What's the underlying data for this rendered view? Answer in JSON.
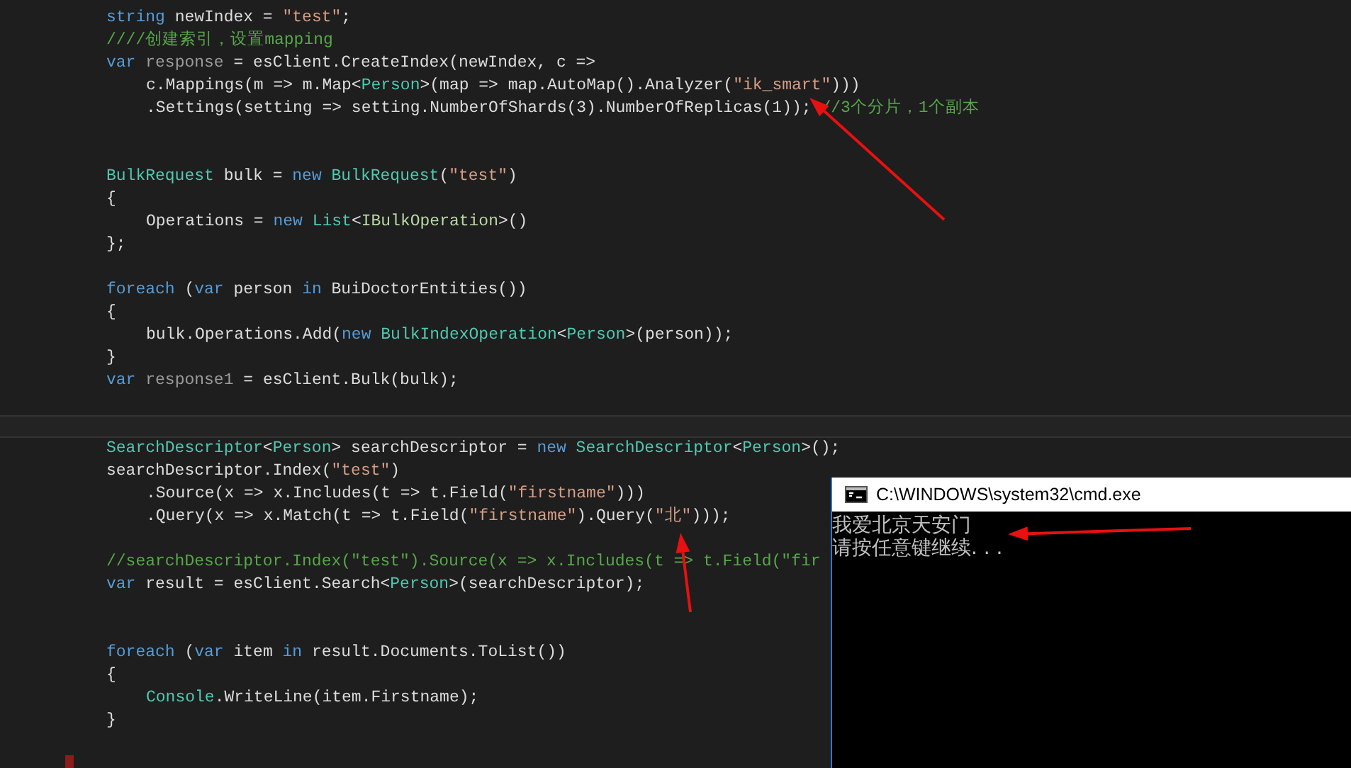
{
  "editor": {
    "lines": [
      {
        "kind": "code",
        "tokens": [
          {
            "kind": "keyword",
            "s": "string"
          },
          {
            "kind": "plain",
            "s": " newIndex = "
          },
          {
            "kind": "string",
            "s": "\"test\""
          },
          {
            "kind": "plain",
            "s": ";"
          }
        ]
      },
      {
        "kind": "code",
        "tokens": [
          {
            "kind": "comment",
            "s": "////创建索引，设置mapping"
          }
        ]
      },
      {
        "kind": "code",
        "tokens": [
          {
            "kind": "keyword",
            "s": "var"
          },
          {
            "kind": "unused",
            "s": " response"
          },
          {
            "kind": "plain",
            "s": " = esClient.CreateIndex(newIndex, c =>"
          }
        ]
      },
      {
        "kind": "indented",
        "tokens": [
          {
            "kind": "plain",
            "s": "c.Mappings(m => m.Map<"
          },
          {
            "kind": "type",
            "s": "Person"
          },
          {
            "kind": "plain",
            "s": ">(map => map.AutoMap().Analyzer("
          },
          {
            "kind": "string",
            "s": "\"ik_smart\""
          },
          {
            "kind": "plain",
            "s": ")))"
          }
        ]
      },
      {
        "kind": "indented",
        "tokens": [
          {
            "kind": "plain",
            "s": ".Settings(setting => setting.NumberOfShards(3).NumberOfReplicas(1)); "
          },
          {
            "kind": "comment",
            "s": "//3个分片，1个副本"
          }
        ]
      },
      {
        "kind": "blank"
      },
      {
        "kind": "blank"
      },
      {
        "kind": "code",
        "tokens": [
          {
            "kind": "type",
            "s": "BulkRequest"
          },
          {
            "kind": "plain",
            "s": " bulk = "
          },
          {
            "kind": "keyword",
            "s": "new"
          },
          {
            "kind": "type",
            "s": " BulkRequest"
          },
          {
            "kind": "plain",
            "s": "("
          },
          {
            "kind": "string",
            "s": "\"test\""
          },
          {
            "kind": "plain",
            "s": ")"
          }
        ]
      },
      {
        "kind": "code",
        "tokens": [
          {
            "kind": "plain",
            "s": "{"
          }
        ]
      },
      {
        "kind": "indented",
        "tokens": [
          {
            "kind": "plain",
            "s": "Operations = "
          },
          {
            "kind": "keyword",
            "s": "new"
          },
          {
            "kind": "type",
            "s": " List"
          },
          {
            "kind": "plain",
            "s": "<"
          },
          {
            "kind": "generic",
            "s": "IBulkOperation"
          },
          {
            "kind": "plain",
            "s": ">()"
          }
        ]
      },
      {
        "kind": "code",
        "tokens": [
          {
            "kind": "plain",
            "s": "};"
          }
        ]
      },
      {
        "kind": "blank"
      },
      {
        "kind": "code",
        "tokens": [
          {
            "kind": "keyword",
            "s": "foreach"
          },
          {
            "kind": "plain",
            "s": " ("
          },
          {
            "kind": "keyword",
            "s": "var"
          },
          {
            "kind": "plain",
            "s": " person "
          },
          {
            "kind": "keyword",
            "s": "in"
          },
          {
            "kind": "plain",
            "s": " BuiDoctorEntities())"
          }
        ]
      },
      {
        "kind": "code",
        "tokens": [
          {
            "kind": "plain",
            "s": "{"
          }
        ]
      },
      {
        "kind": "indented",
        "tokens": [
          {
            "kind": "plain",
            "s": "bulk.Operations.Add("
          },
          {
            "kind": "keyword",
            "s": "new"
          },
          {
            "kind": "type",
            "s": " BulkIndexOperation"
          },
          {
            "kind": "plain",
            "s": "<"
          },
          {
            "kind": "type",
            "s": "Person"
          },
          {
            "kind": "plain",
            "s": ">(person));"
          }
        ]
      },
      {
        "kind": "code",
        "tokens": [
          {
            "kind": "plain",
            "s": "}"
          }
        ]
      },
      {
        "kind": "code",
        "tokens": [
          {
            "kind": "keyword",
            "s": "var"
          },
          {
            "kind": "unused",
            "s": " response1"
          },
          {
            "kind": "plain",
            "s": " = esClient.Bulk(bulk);"
          }
        ]
      },
      {
        "kind": "blank"
      },
      {
        "kind": "current"
      },
      {
        "kind": "code",
        "tokens": [
          {
            "kind": "type",
            "s": "SearchDescriptor"
          },
          {
            "kind": "plain",
            "s": "<"
          },
          {
            "kind": "type",
            "s": "Person"
          },
          {
            "kind": "plain",
            "s": "> searchDescriptor = "
          },
          {
            "kind": "keyword",
            "s": "new"
          },
          {
            "kind": "type",
            "s": " SearchDescriptor"
          },
          {
            "kind": "plain",
            "s": "<"
          },
          {
            "kind": "type",
            "s": "Person"
          },
          {
            "kind": "plain",
            "s": ">();"
          }
        ]
      },
      {
        "kind": "code",
        "tokens": [
          {
            "kind": "plain",
            "s": "searchDescriptor.Index("
          },
          {
            "kind": "string",
            "s": "\"test\""
          },
          {
            "kind": "plain",
            "s": ")"
          }
        ]
      },
      {
        "kind": "indented",
        "tokens": [
          {
            "kind": "plain",
            "s": ".Source(x => x.Includes(t => t.Field("
          },
          {
            "kind": "string",
            "s": "\"firstname\""
          },
          {
            "kind": "plain",
            "s": ")))"
          }
        ]
      },
      {
        "kind": "indented",
        "tokens": [
          {
            "kind": "plain",
            "s": ".Query(x => x.Match(t => t.Field("
          },
          {
            "kind": "string",
            "s": "\"firstname\""
          },
          {
            "kind": "plain",
            "s": ").Query("
          },
          {
            "kind": "string",
            "s": "\"北\""
          },
          {
            "kind": "plain",
            "s": ")));"
          }
        ]
      },
      {
        "kind": "blank"
      },
      {
        "kind": "code",
        "tokens": [
          {
            "kind": "comment",
            "s": "//searchDescriptor.Index(\"test\").Source(x => x.Includes(t => t.Field(\"fir"
          }
        ]
      },
      {
        "kind": "code",
        "tokens": [
          {
            "kind": "keyword",
            "s": "var"
          },
          {
            "kind": "plain",
            "s": " result = esClient.Search<"
          },
          {
            "kind": "type",
            "s": "Person"
          },
          {
            "kind": "plain",
            "s": ">(searchDescriptor);"
          }
        ]
      },
      {
        "kind": "blank"
      },
      {
        "kind": "blank"
      },
      {
        "kind": "code",
        "tokens": [
          {
            "kind": "keyword",
            "s": "foreach"
          },
          {
            "kind": "plain",
            "s": " ("
          },
          {
            "kind": "keyword",
            "s": "var"
          },
          {
            "kind": "plain",
            "s": " item "
          },
          {
            "kind": "keyword",
            "s": "in"
          },
          {
            "kind": "plain",
            "s": " result.Documents.ToList())"
          }
        ]
      },
      {
        "kind": "code",
        "tokens": [
          {
            "kind": "plain",
            "s": "{"
          }
        ]
      },
      {
        "kind": "indented",
        "tokens": [
          {
            "kind": "type",
            "s": "Console"
          },
          {
            "kind": "plain",
            "s": ".WriteLine(item.Firstname);"
          }
        ]
      },
      {
        "kind": "code",
        "tokens": [
          {
            "kind": "plain",
            "s": "}"
          }
        ]
      }
    ]
  },
  "console_window": {
    "title": "C:\\WINDOWS\\system32\\cmd.exe",
    "output": [
      "我爱北京天安门",
      "请按任意键继续. . ."
    ]
  }
}
